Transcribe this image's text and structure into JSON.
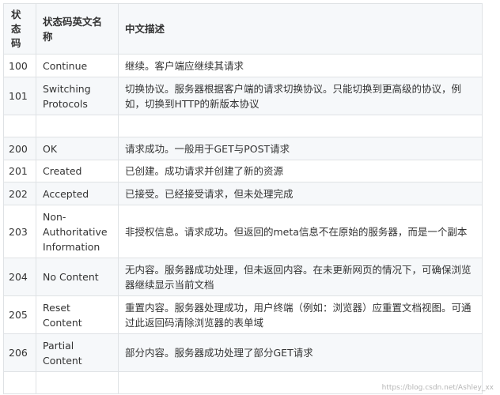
{
  "table": {
    "headers": {
      "code": "状态码",
      "name": "状态码英文名称",
      "desc": "中文描述"
    },
    "rows": [
      {
        "code": "100",
        "name": "Continue",
        "desc": "继续。客户端应继续其请求"
      },
      {
        "code": "101",
        "name": "Switching Protocols",
        "desc": "切换协议。服务器根据客户端的请求切换协议。只能切换到更高级的协议，例如，切换到HTTP的新版本协议"
      },
      {
        "code": "",
        "name": "",
        "desc": ""
      },
      {
        "code": "200",
        "name": "OK",
        "desc": "请求成功。一般用于GET与POST请求"
      },
      {
        "code": "201",
        "name": "Created",
        "desc": "已创建。成功请求并创建了新的资源"
      },
      {
        "code": "202",
        "name": "Accepted",
        "desc": "已接受。已经接受请求，但未处理完成"
      },
      {
        "code": "203",
        "name": "Non-Authoritative Information",
        "desc": "非授权信息。请求成功。但返回的meta信息不在原始的服务器，而是一个副本"
      },
      {
        "code": "204",
        "name": "No Content",
        "desc": "无内容。服务器成功处理，但未返回内容。在未更新网页的情况下，可确保浏览器继续显示当前文档"
      },
      {
        "code": "205",
        "name": "Reset Content",
        "desc": "重置内容。服务器处理成功，用户终端（例如：浏览器）应重置文档视图。可通过此返回码清除浏览器的表单域"
      },
      {
        "code": "206",
        "name": "Partial Content",
        "desc": "部分内容。服务器成功处理了部分GET请求"
      },
      {
        "code": "",
        "name": "",
        "desc": ""
      }
    ]
  },
  "watermark": "https://blog.csdn.net/Ashley_xx"
}
